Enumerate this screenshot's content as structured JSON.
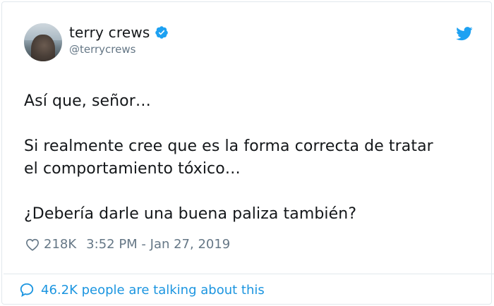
{
  "author": {
    "name": "terry crews",
    "handle": "@terrycrews",
    "verified": true
  },
  "tweet": {
    "lines": [
      "Así que, señor…",
      "Si realmente cree que es la forma correcta de tratar",
      "el comportamiento tóxico…",
      "¿Debería darle una buena paliza también?"
    ]
  },
  "meta": {
    "likes": "218K",
    "timestamp": "3:52 PM - Jan 27, 2019"
  },
  "footer": {
    "conversation": "46.2K people are talking about this"
  },
  "colors": {
    "accent": "#1da1f2",
    "link": "#1b95e0",
    "muted": "#657786"
  },
  "icons": [
    "verified-badge-icon",
    "twitter-bird-icon",
    "heart-icon",
    "speech-bubble-icon"
  ]
}
